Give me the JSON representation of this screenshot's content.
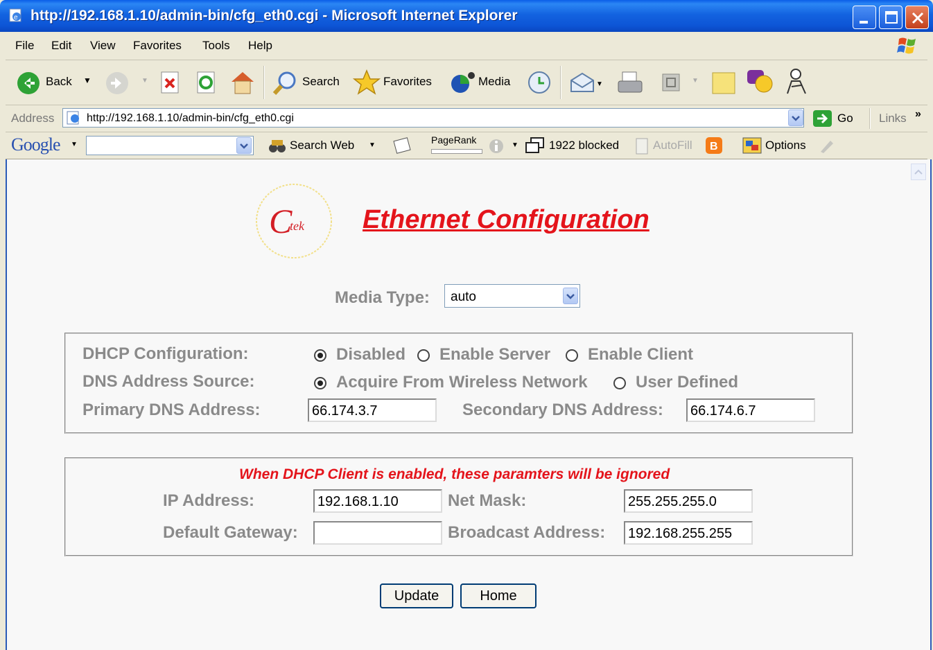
{
  "window": {
    "title": "http://192.168.1.10/admin-bin/cfg_eth0.cgi - Microsoft Internet Explorer"
  },
  "menu": [
    "File",
    "Edit",
    "View",
    "Favorites",
    "Tools",
    "Help"
  ],
  "toolbar": {
    "back": "Back",
    "search": "Search",
    "favorites": "Favorites",
    "media": "Media"
  },
  "address": {
    "label": "Address",
    "url": "http://192.168.1.10/admin-bin/cfg_eth0.cgi",
    "go": "Go",
    "links": "Links"
  },
  "google": {
    "brand": "Google",
    "search_web": "Search Web",
    "pagerank": "PageRank",
    "blocked": "1922 blocked",
    "autofill": "AutoFill",
    "options": "Options"
  },
  "page": {
    "logo_text": "Ctek",
    "title": "Ethernet Configuration",
    "media_type_label": "Media Type:",
    "media_type_value": "auto",
    "dhcp": {
      "label": "DHCP Configuration:",
      "options": [
        "Disabled",
        "Enable Server",
        "Enable Client"
      ],
      "selected": "Disabled"
    },
    "dns_source": {
      "label": "DNS Address Source:",
      "options": [
        "Acquire From Wireless Network",
        "User Defined"
      ],
      "selected": "Acquire From Wireless Network"
    },
    "primary_dns_label": "Primary DNS Address:",
    "primary_dns": "66.174.3.7",
    "secondary_dns_label": "Secondary DNS Address:",
    "secondary_dns": "66.174.6.7",
    "notice": "When DHCP Client is enabled, these paramters will be ignored",
    "ip_label": "IP Address:",
    "ip": "192.168.1.10",
    "netmask_label": "Net Mask:",
    "netmask": "255.255.255.0",
    "gateway_label": "Default Gateway:",
    "gateway": "",
    "broadcast_label": "Broadcast Address:",
    "broadcast": "192.168.255.255",
    "update_button": "Update",
    "home_button": "Home"
  }
}
